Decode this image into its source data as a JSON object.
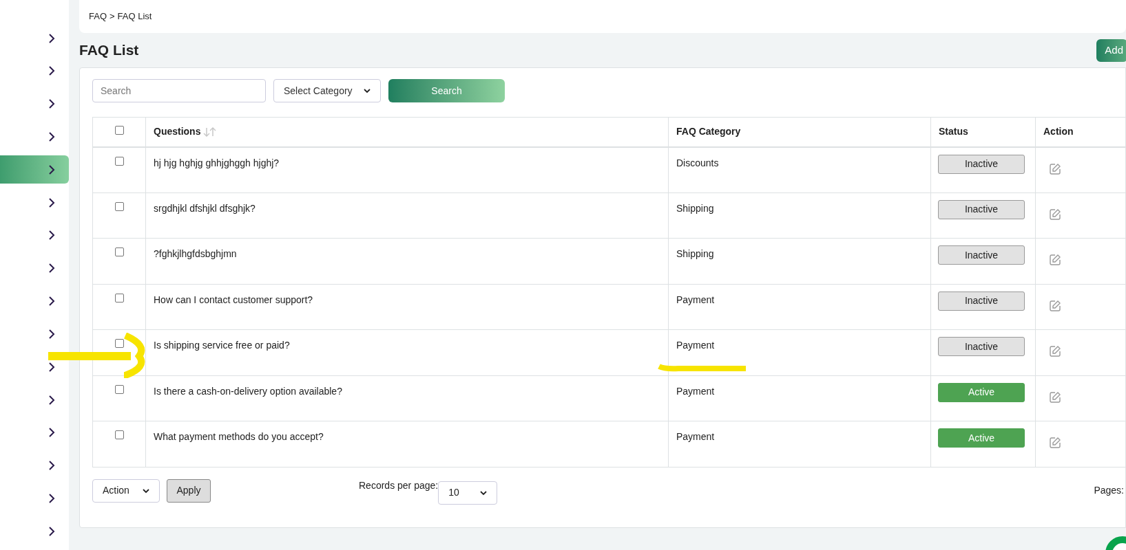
{
  "sidebar": {
    "items": [
      {
        "selected": false
      },
      {
        "selected": false
      },
      {
        "selected": false
      },
      {
        "selected": false
      },
      {
        "selected": true
      },
      {
        "selected": false
      },
      {
        "selected": false
      },
      {
        "selected": false
      },
      {
        "selected": false
      },
      {
        "selected": false
      },
      {
        "selected": false
      },
      {
        "selected": false
      },
      {
        "selected": false
      },
      {
        "selected": false
      },
      {
        "selected": false
      },
      {
        "selected": false
      }
    ]
  },
  "breadcrumb": {
    "items": [
      "FAQ",
      "FAQ List"
    ],
    "separator": ">"
  },
  "title": "FAQ List",
  "add_button": "Add",
  "filters": {
    "search_placeholder": "Search",
    "category_select": "Select Category",
    "search_button": "Search"
  },
  "table": {
    "columns": [
      "Questions",
      "FAQ Category",
      "Status",
      "Action"
    ],
    "header_checked": false,
    "rows": [
      {
        "checked": false,
        "question": "hj hjg hghjg ghhjghggh hjghj?",
        "category": "Discounts",
        "status": "Inactive",
        "active": false
      },
      {
        "checked": false,
        "question": "srgdhjkl dfshjkl dfsghjk?",
        "category": "Shipping",
        "status": "Inactive",
        "active": false
      },
      {
        "checked": false,
        "question": "?fghkjlhgfdsbghjmn",
        "category": "Shipping",
        "status": "Inactive",
        "active": false
      },
      {
        "checked": false,
        "question": "How can I contact customer support?",
        "category": "Payment",
        "status": "Inactive",
        "active": false
      },
      {
        "checked": false,
        "question": "Is shipping service free or paid?",
        "category": "Payment",
        "status": "Inactive",
        "active": false
      },
      {
        "checked": false,
        "question": "Is there a cash-on-delivery option available?",
        "category": "Payment",
        "status": "Active",
        "active": true
      },
      {
        "checked": false,
        "question": "What payment methods do you accept?",
        "category": "Payment",
        "status": "Active",
        "active": true
      }
    ]
  },
  "footer": {
    "action_select": "Action",
    "apply_button": "Apply",
    "records_label": "Records per page:",
    "records_select": "10",
    "pages_label": "Pages:"
  }
}
